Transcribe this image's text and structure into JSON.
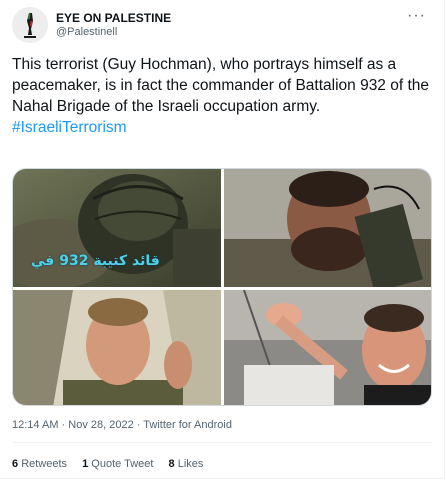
{
  "author": {
    "display_name": "EYE ON PALESTINE",
    "handle": "@Palestinell",
    "avatar_icon": "eye-on-palestine-logo"
  },
  "more_icon": "more-options-icon",
  "tweet": {
    "text": "This terrorist (Guy Hochman), who portrays himself as a peacemaker, is in fact the commander of Battalion 932 of the Nahal Brigade of the Israeli occupation army.",
    "hashtag": "#IsraeliTerrorism"
  },
  "media": {
    "photo1_caption": "قائد كتيبة 932 في"
  },
  "meta": {
    "time": "12:14 AM",
    "sep1": " · ",
    "date": "Nov 28, 2022",
    "sep2": " · ",
    "source": "Twitter for Android"
  },
  "stats": {
    "retweets_count": "6",
    "retweets_label": "Retweets",
    "quotes_count": "1",
    "quotes_label": "Quote Tweet",
    "likes_count": "8",
    "likes_label": "Likes"
  },
  "colors": {
    "link": "#1d9bf0",
    "secondary_text": "#536471",
    "border": "#cfd9de"
  }
}
